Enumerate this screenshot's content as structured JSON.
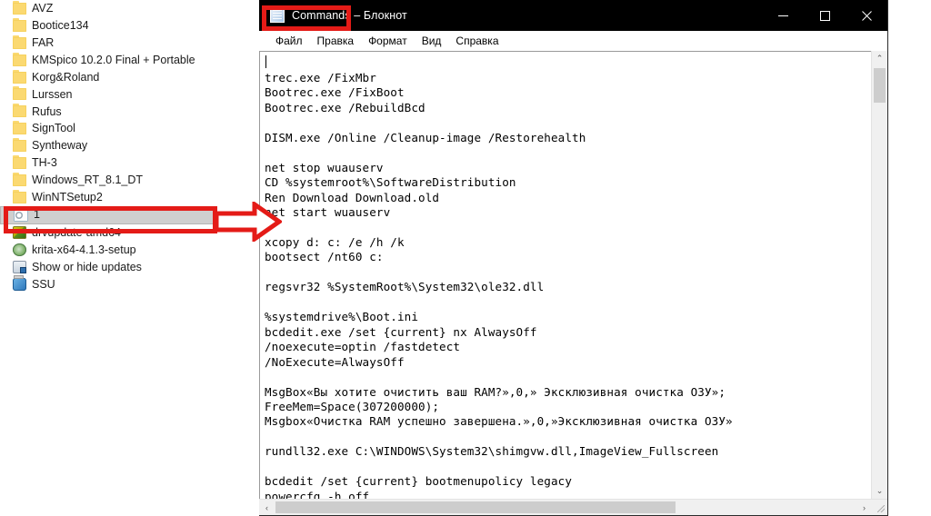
{
  "file_list": {
    "items": [
      {
        "label": "AVZ",
        "icon": "folder-icon",
        "type": "folder",
        "selected": false
      },
      {
        "label": "Bootice134",
        "icon": "folder-icon",
        "type": "folder",
        "selected": false
      },
      {
        "label": "FAR",
        "icon": "folder-icon",
        "type": "folder",
        "selected": false
      },
      {
        "label": "KMSpico 10.2.0 Final + Portable",
        "icon": "folder-icon",
        "type": "folder",
        "selected": false
      },
      {
        "label": "Korg&Roland",
        "icon": "folder-icon",
        "type": "folder",
        "selected": false
      },
      {
        "label": "Lurssen",
        "icon": "folder-icon",
        "type": "folder",
        "selected": false
      },
      {
        "label": "Rufus",
        "icon": "folder-icon",
        "type": "folder",
        "selected": false
      },
      {
        "label": "SignTool",
        "icon": "folder-icon",
        "type": "folder",
        "selected": false
      },
      {
        "label": "Syntheway",
        "icon": "folder-icon",
        "type": "folder",
        "selected": false
      },
      {
        "label": "TH-3",
        "icon": "folder-icon",
        "type": "folder",
        "selected": false
      },
      {
        "label": "Windows_RT_8.1_DT",
        "icon": "folder-icon",
        "type": "folder",
        "selected": false
      },
      {
        "label": "WinNTSetup2",
        "icon": "folder-icon",
        "type": "folder",
        "selected": false
      },
      {
        "label": "1",
        "icon": "text-file-icon",
        "type": "file",
        "selected": true
      },
      {
        "label": "drvupdate-amd64",
        "icon": "installer-icon",
        "type": "file",
        "selected": false
      },
      {
        "label": "krita-x64-4.1.3-setup",
        "icon": "krita-icon",
        "type": "file",
        "selected": false
      },
      {
        "label": "Show or hide updates",
        "icon": "troubleshooter-icon",
        "type": "file",
        "selected": false
      },
      {
        "label": "SSU",
        "icon": "update-icon",
        "type": "file",
        "selected": false
      }
    ]
  },
  "annotations": {
    "color": "#e41b17",
    "list_rect_target": "1",
    "arrow_direction": "right",
    "title_rect_target": "Commands"
  },
  "notepad": {
    "title": {
      "document_name": "Commands",
      "separator": " – ",
      "app_name": "Блокнот"
    },
    "icon": "notepad-icon",
    "window_buttons": [
      {
        "name": "minimize",
        "glyph": "—"
      },
      {
        "name": "maximize",
        "glyph": "□"
      },
      {
        "name": "close",
        "glyph": "✕"
      }
    ],
    "menu": [
      {
        "label": "Файл"
      },
      {
        "label": "Правка"
      },
      {
        "label": "Формат"
      },
      {
        "label": "Вид"
      },
      {
        "label": "Справка"
      }
    ],
    "content": "trec.exe /FixMbr\nBootrec.exe /FixBoot\nBootrec.exe /RebuildBcd\n\nDISM.exe /Online /Cleanup-image /Restorehealth\n\nnet stop wuauserv\nCD %systemroot%\\SoftwareDistribution\nRen Download Download.old\nnet start wuauserv\n\nxcopy d: c: /e /h /k\nbootsect /nt60 c:\n\nregsvr32 %SystemRoot%\\System32\\ole32.dll\n\n%systemdrive%\\Boot.ini\nbcdedit.exe /set {current} nx AlwaysOff\n/noexecute=optin /fastdetect\n/NoExecute=AlwaysOff\n\nMsgBox«Вы хотите очистить ваш RAM?»,0,» Эксклюзивная очистка ОЗУ»;\nFreeMem=Space(307200000);\nMsgbox«Очистка RAM успешно завершена.»,0,»Эксклюзивная очистка ОЗУ»\n\nrundll32.exe C:\\WINDOWS\\System32\\shimgvw.dll,ImageView_Fullscreen\n\nbcdedit /set {current} bootmenupolicy legacy\npowercfg -h off",
    "scrollbars": {
      "vertical_up": "⌃",
      "vertical_down": "⌄",
      "horizontal_left": "‹",
      "horizontal_right": "›"
    }
  }
}
